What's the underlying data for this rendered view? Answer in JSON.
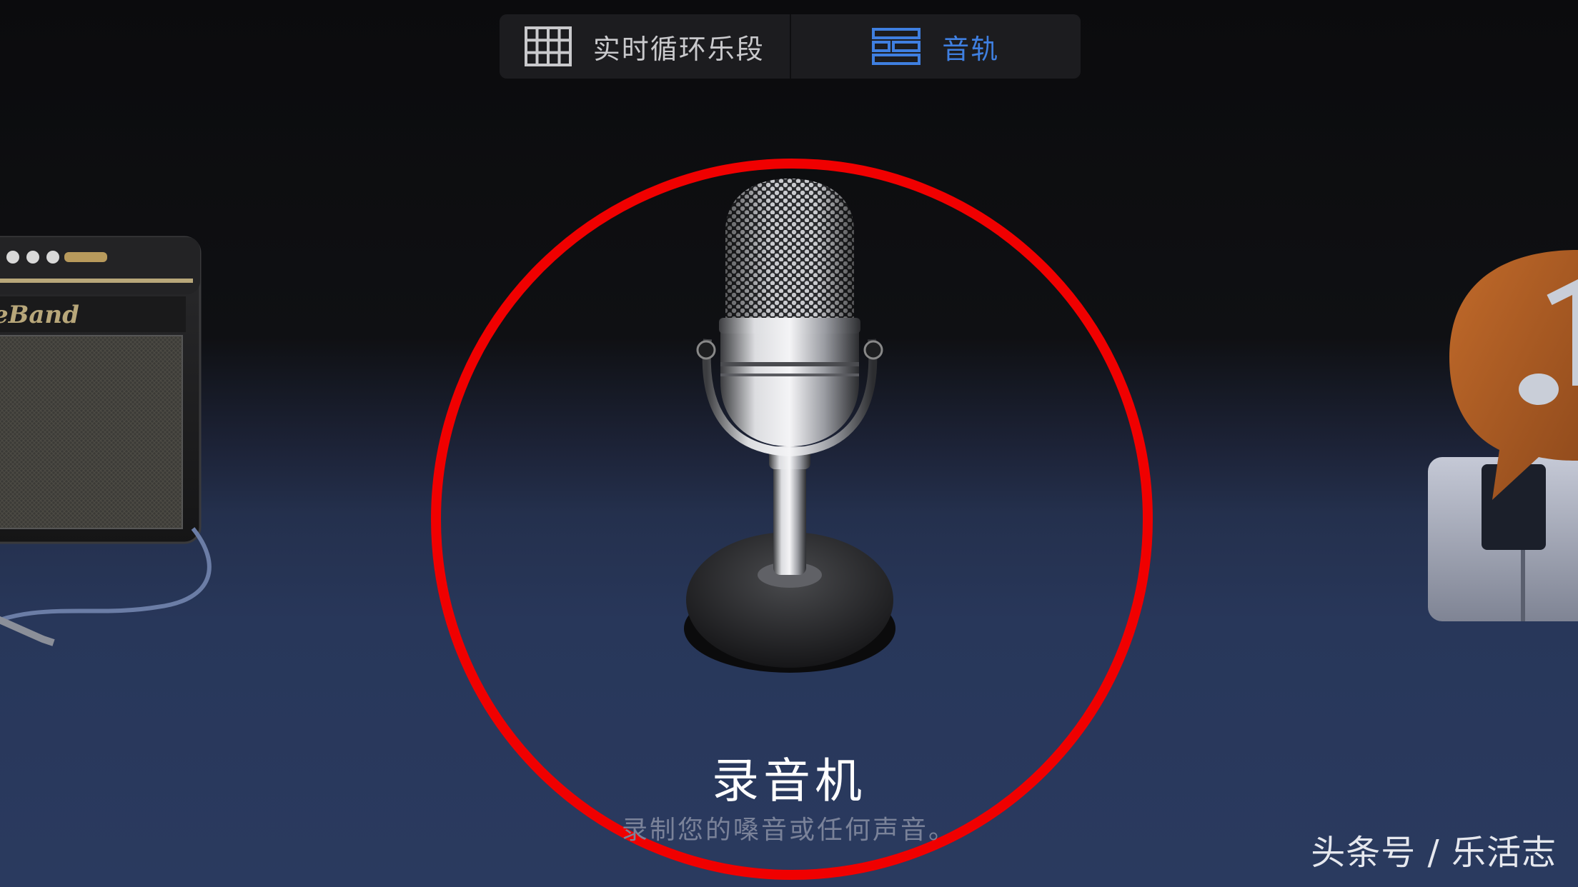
{
  "tabs": [
    {
      "label": "实时循环乐段",
      "icon": "grid-icon",
      "active": false
    },
    {
      "label": "音轨",
      "icon": "tracks-icon",
      "active": true
    }
  ],
  "instrument": {
    "title": "录音机",
    "description": "录制您的嗓音或任何声音。"
  },
  "side_instruments": {
    "left": {
      "logo_text": "eBand",
      "icon": "amp-icon"
    },
    "right": {
      "icon": "keyboard-icon"
    }
  },
  "watermark": "头条号 / 乐活志",
  "colors": {
    "accent": "#3f7fe0",
    "highlight": "#f00000"
  }
}
